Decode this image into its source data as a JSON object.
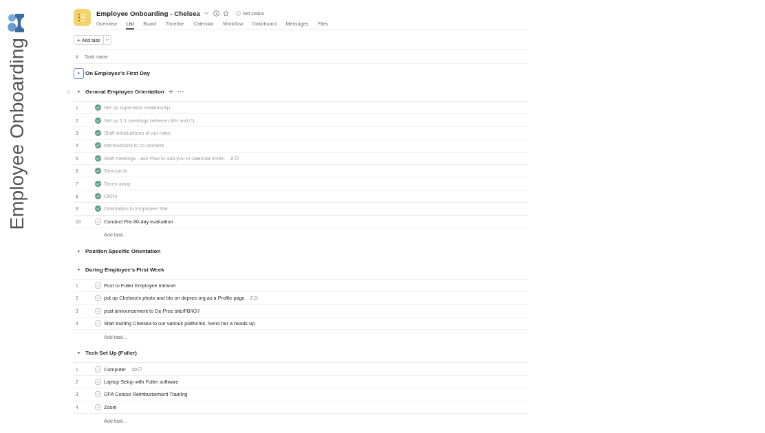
{
  "sidebar": {
    "title": "Employee Onboarding"
  },
  "project": {
    "title": "Employee Onboarding - Chelsea",
    "status_label": "Set status",
    "tabs": [
      {
        "label": "Overview",
        "selected": false
      },
      {
        "label": "List",
        "selected": true
      },
      {
        "label": "Board",
        "selected": false
      },
      {
        "label": "Timeline",
        "selected": false
      },
      {
        "label": "Calendar",
        "selected": false
      },
      {
        "label": "Workflow",
        "selected": false
      },
      {
        "label": "Dashboard",
        "selected": false
      },
      {
        "label": "Messages",
        "selected": false
      },
      {
        "label": "Files",
        "selected": false
      }
    ]
  },
  "toolbar": {
    "add_label": "Add task"
  },
  "table": {
    "columns": [
      "#",
      "Task name"
    ]
  },
  "sections": [
    {
      "title": "On Employee's First Day",
      "expanded": false,
      "focused": true,
      "hovered": false
    },
    {
      "title": "General Employee Orientation",
      "expanded": true,
      "focused": false,
      "hovered": true,
      "tasks": [
        {
          "number": "1",
          "name": "Set up supervisor relationship",
          "completed": true
        },
        {
          "number": "2",
          "name": "Set up 1:1 meetings between MH and CL",
          "completed": true
        },
        {
          "number": "3",
          "name": "Staff introductions of our roles",
          "completed": true
        },
        {
          "number": "4",
          "name": "Introductions to co-workers",
          "completed": true
        },
        {
          "number": "5",
          "name": "Staff meetings - ask Paul to add you to calendar invite.",
          "completed": true,
          "comments": "2"
        },
        {
          "number": "6",
          "name": "Timecards",
          "completed": true
        },
        {
          "number": "7",
          "name": "Times away",
          "completed": true
        },
        {
          "number": "8",
          "name": "OKRs",
          "completed": true
        },
        {
          "number": "9",
          "name": "Orientation to Employee Site",
          "completed": true
        },
        {
          "number": "10",
          "name": "Conduct Pre-90-day evaluation",
          "completed": false
        }
      ],
      "add_label": "Add task..."
    },
    {
      "title": "Position Specific Orientation",
      "expanded": false,
      "focused": false,
      "hovered": false
    },
    {
      "title": "During Employee's First Week",
      "expanded": true,
      "focused": false,
      "hovered": false,
      "tasks": [
        {
          "number": "1",
          "name": "Post to Fuller Employee Intranet",
          "completed": false
        },
        {
          "number": "2",
          "name": "put up Chelsea's photo and bio on depree.org as a Profile page",
          "completed": false,
          "comments": "2"
        },
        {
          "number": "3",
          "name": "post announcement to De Pree site/FB/IG?",
          "completed": false
        },
        {
          "number": "4",
          "name": "Start inviting Chelsea to our various platforms. Send her a heads up.",
          "completed": false
        }
      ],
      "add_label": "Add task..."
    },
    {
      "title": "Tech Set Up (Fuller)",
      "expanded": true,
      "focused": false,
      "hovered": false,
      "tasks": [
        {
          "number": "1",
          "name": "Computer",
          "completed": false,
          "comments": "10"
        },
        {
          "number": "2",
          "name": "Laptop Setup with Fuller software",
          "completed": false
        },
        {
          "number": "3",
          "name": "OFA Concur Reimbursement Training",
          "completed": false
        },
        {
          "number": "4",
          "name": "Zoom",
          "completed": false
        }
      ],
      "add_label": "Add task..."
    }
  ]
}
